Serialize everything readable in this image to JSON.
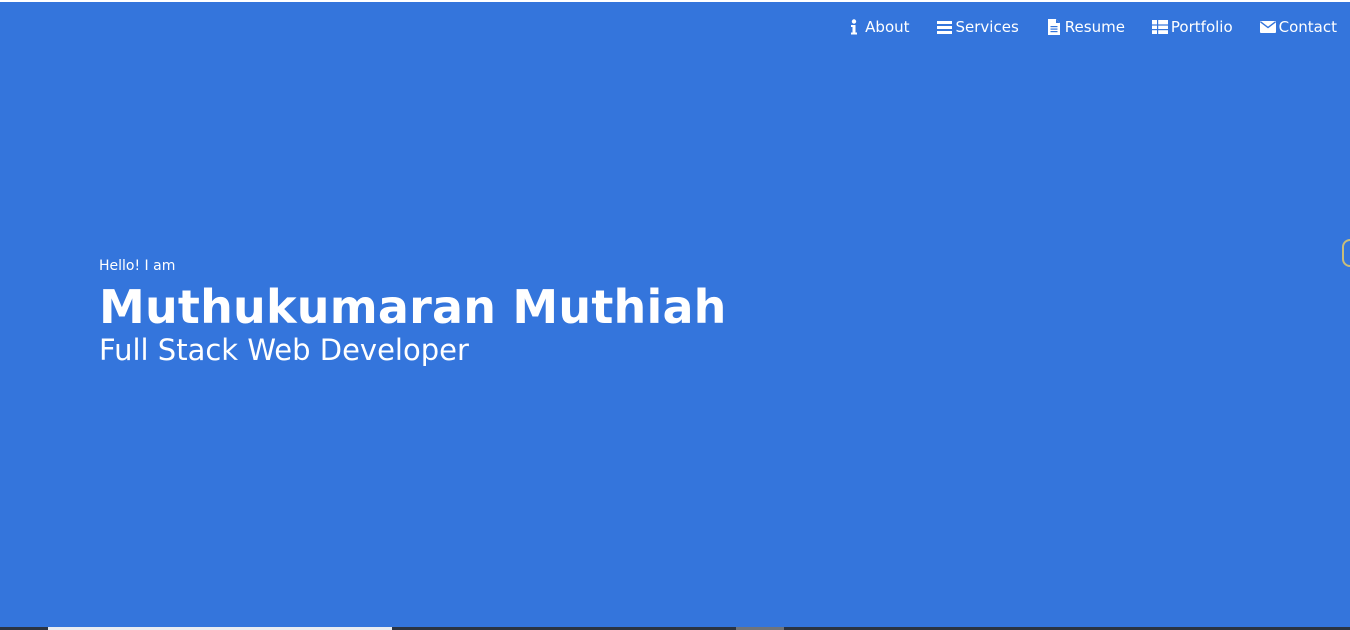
{
  "nav": {
    "items": [
      {
        "label": "About",
        "icon": "info-icon"
      },
      {
        "label": "Services",
        "icon": "list-icon"
      },
      {
        "label": "Resume",
        "icon": "file-icon"
      },
      {
        "label": "Portfolio",
        "icon": "table-icon"
      },
      {
        "label": "Contact",
        "icon": "envelope-icon"
      }
    ]
  },
  "hero": {
    "greeting": "Hello! I am",
    "name": "Muthukumaran Muthiah",
    "role": "Full Stack Web Developer"
  },
  "colors": {
    "hero_background": "#3475dc",
    "text": "#ffffff",
    "footer_strip": "#2b3442"
  }
}
